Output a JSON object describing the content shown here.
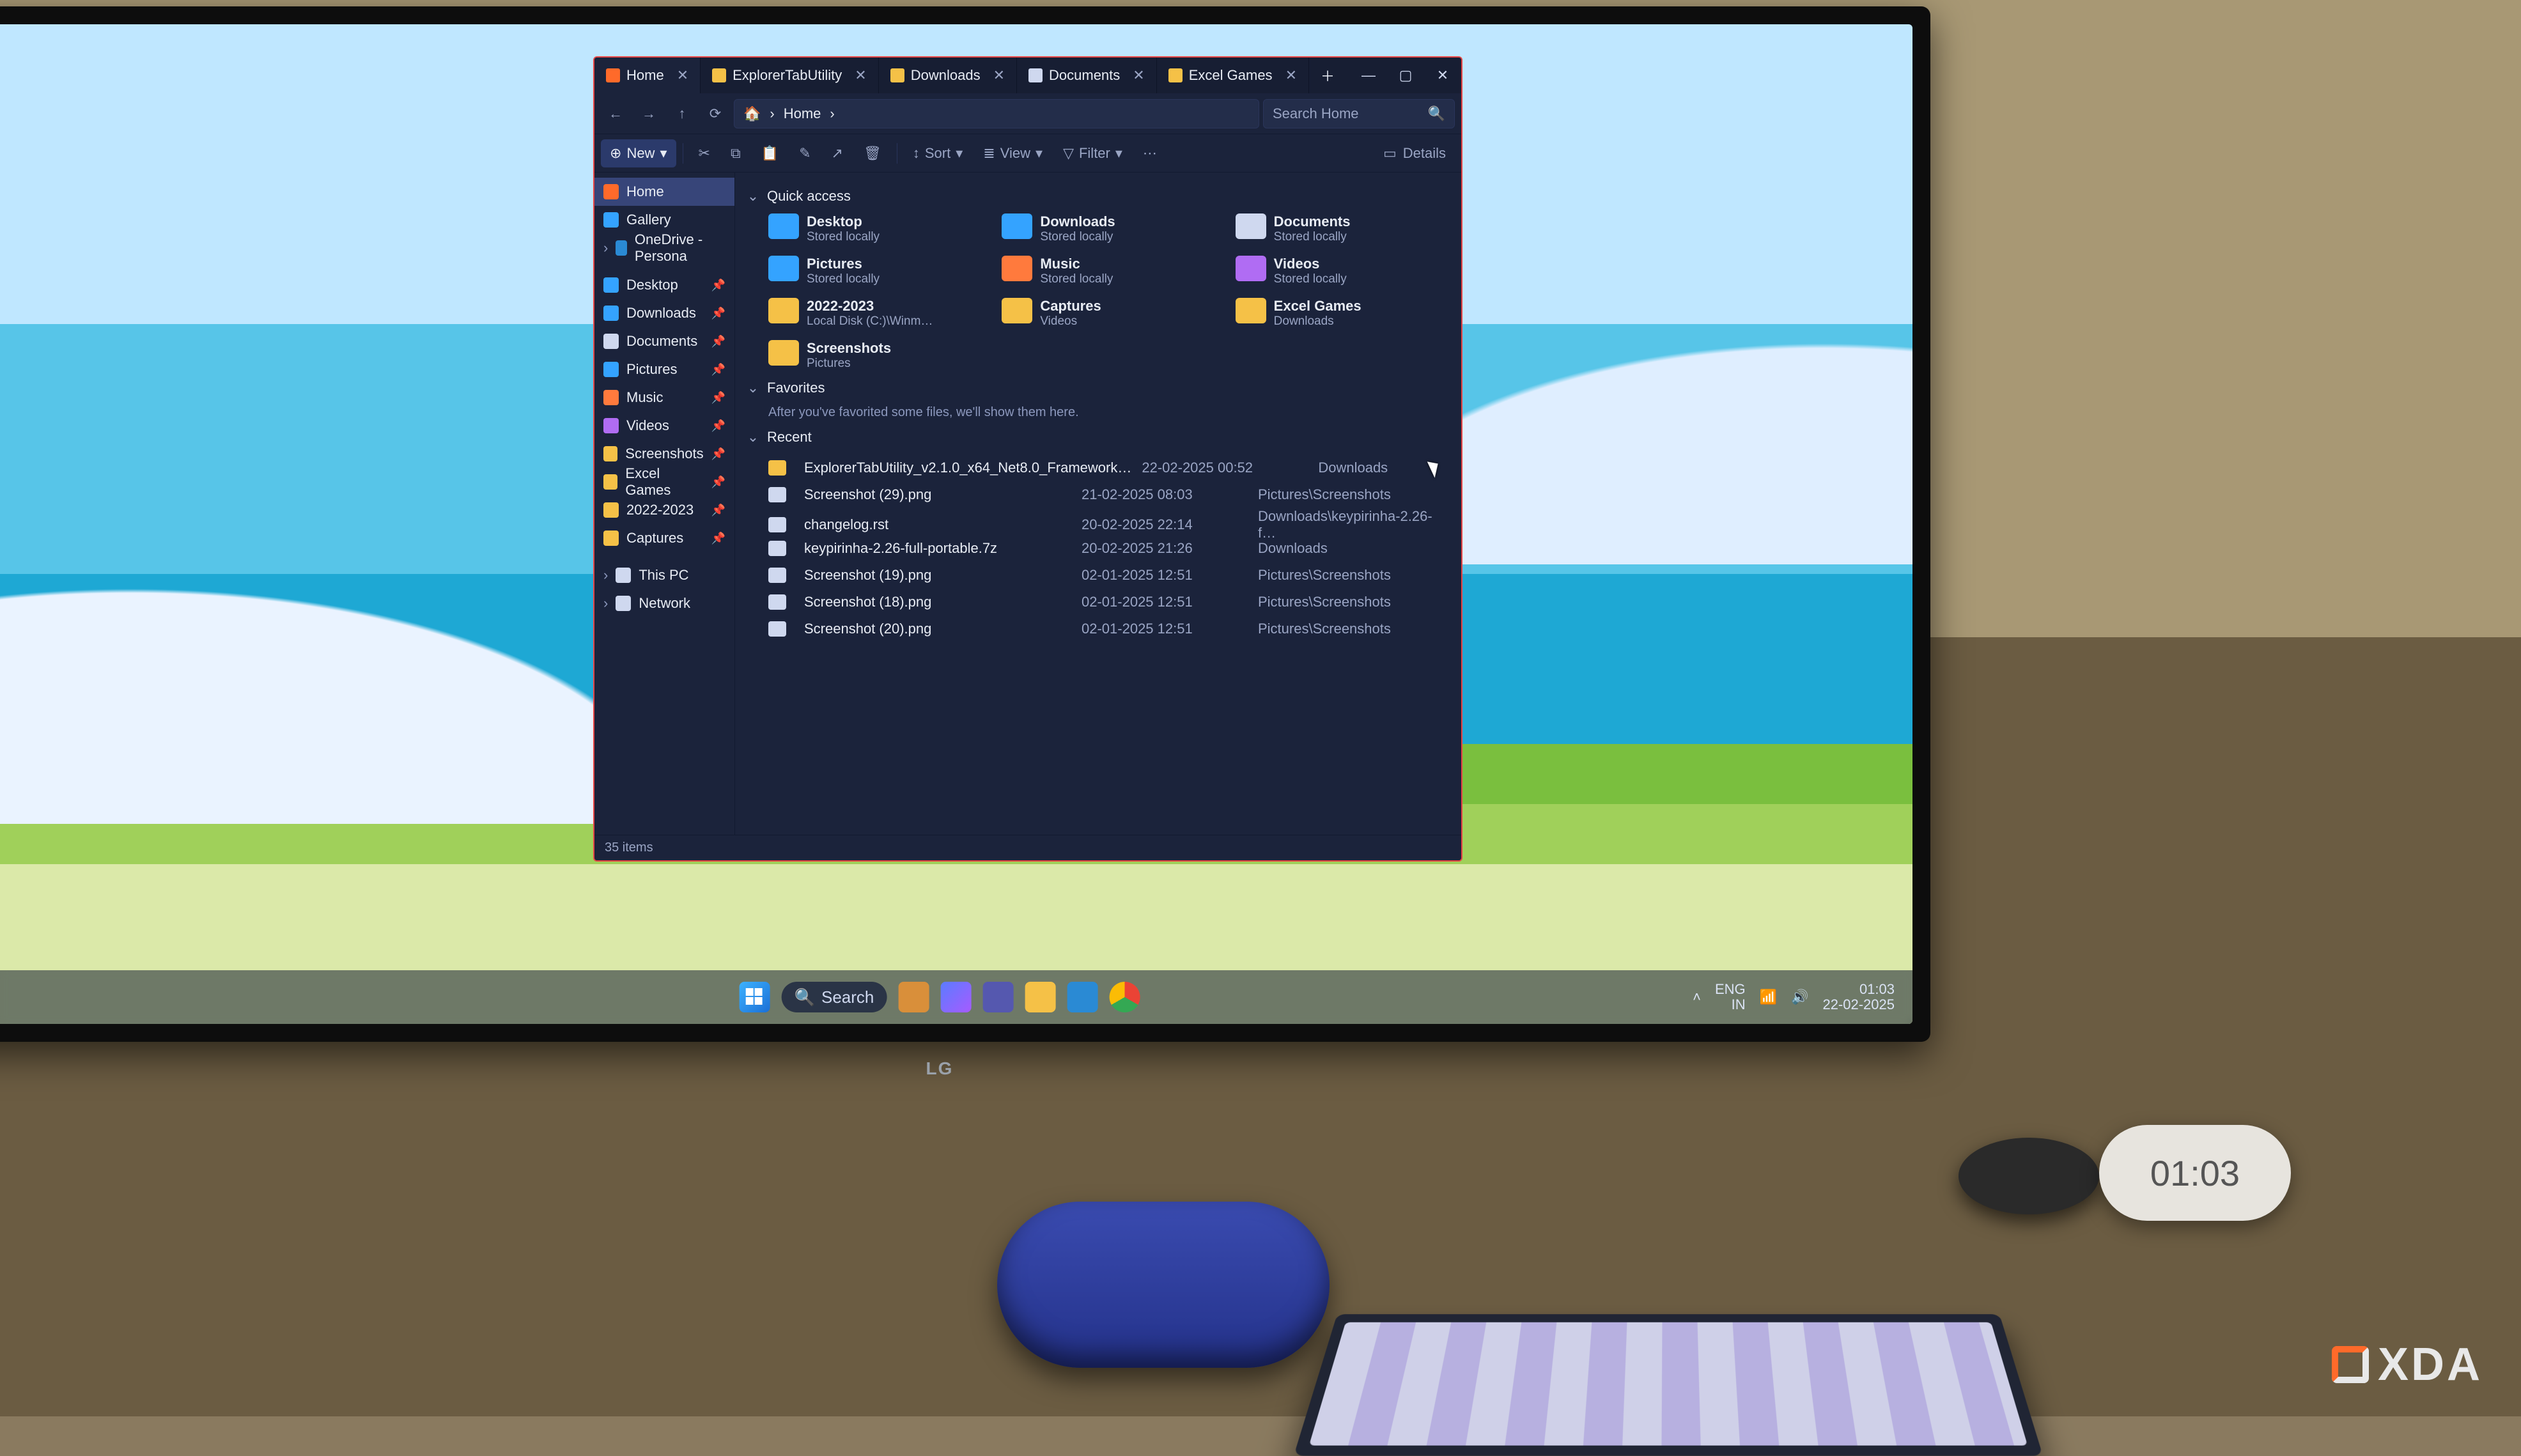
{
  "taskbar": {
    "search_label": "Search",
    "lang_top": "ENG",
    "lang_bottom": "IN",
    "time": "01:03",
    "date": "22-02-2025"
  },
  "desk_clock": "01:03",
  "monitor_brand": "LG",
  "watermark": "XDA",
  "explorer": {
    "tabs": [
      {
        "label": "Home",
        "icon_color": "#ff6a2a",
        "active": true
      },
      {
        "label": "ExplorerTabUtility",
        "icon_color": "#f5c147",
        "active": false
      },
      {
        "label": "Downloads",
        "icon_color": "#f5c147",
        "active": false
      },
      {
        "label": "Documents",
        "icon_color": "#cfd8ef",
        "active": false
      },
      {
        "label": "Excel Games",
        "icon_color": "#f5c147",
        "active": false
      }
    ],
    "breadcrumb": "Home",
    "search_placeholder": "Search Home",
    "toolbar": {
      "new": "New",
      "sort": "Sort",
      "view": "View",
      "filter": "Filter",
      "details": "Details"
    },
    "sidebar": {
      "top": [
        {
          "label": "Home",
          "color": "#ff6a2a",
          "selected": true
        },
        {
          "label": "Gallery",
          "color": "#34a3ff",
          "selected": false
        },
        {
          "label": "OneDrive - Persona",
          "color": "#2a8ad4",
          "selected": false
        }
      ],
      "pinned": [
        {
          "label": "Desktop",
          "color": "#34a3ff"
        },
        {
          "label": "Downloads",
          "color": "#34a3ff"
        },
        {
          "label": "Documents",
          "color": "#cfd8ef"
        },
        {
          "label": "Pictures",
          "color": "#34a3ff"
        },
        {
          "label": "Music",
          "color": "#ff7a3d"
        },
        {
          "label": "Videos",
          "color": "#b06cf3"
        },
        {
          "label": "Screenshots",
          "color": "#f5c147"
        },
        {
          "label": "Excel Games",
          "color": "#f5c147"
        },
        {
          "label": "2022-2023",
          "color": "#f5c147"
        },
        {
          "label": "Captures",
          "color": "#f5c147"
        }
      ],
      "bottom": [
        {
          "label": "This PC",
          "color": "#cfd8ef"
        },
        {
          "label": "Network",
          "color": "#cfd8ef"
        }
      ]
    },
    "sections": {
      "quick_access": "Quick access",
      "favorites": "Favorites",
      "favorites_empty": "After you've favorited some files, we'll show them here.",
      "recent": "Recent"
    },
    "quick_access": [
      {
        "label": "Desktop",
        "sub": "Stored locally",
        "color": "#34a3ff"
      },
      {
        "label": "Downloads",
        "sub": "Stored locally",
        "color": "#34a3ff"
      },
      {
        "label": "Documents",
        "sub": "Stored locally",
        "color": "#cfd8ef"
      },
      {
        "label": "Pictures",
        "sub": "Stored locally",
        "color": "#34a3ff"
      },
      {
        "label": "Music",
        "sub": "Stored locally",
        "color": "#ff7a3d"
      },
      {
        "label": "Videos",
        "sub": "Stored locally",
        "color": "#b06cf3"
      },
      {
        "label": "2022-2023",
        "sub": "Local Disk (C:)\\Winm…",
        "color": "#f5c147"
      },
      {
        "label": "Captures",
        "sub": "Videos",
        "color": "#f5c147"
      },
      {
        "label": "Excel Games",
        "sub": "Downloads",
        "color": "#f5c147"
      },
      {
        "label": "Screenshots",
        "sub": "Pictures",
        "color": "#f5c147"
      }
    ],
    "recent": [
      {
        "name": "ExplorerTabUtility_v2.1.0_x64_Net8.0_Framework…",
        "date": "22-02-2025 00:52",
        "loc": "Downloads",
        "color": "#f5c147"
      },
      {
        "name": "Screenshot (29).png",
        "date": "21-02-2025 08:03",
        "loc": "Pictures\\Screenshots",
        "color": "#cfd8ef"
      },
      {
        "name": "changelog.rst",
        "date": "20-02-2025 22:14",
        "loc": "Downloads\\keypirinha-2.26-f…",
        "color": "#cfd8ef"
      },
      {
        "name": "keypirinha-2.26-full-portable.7z",
        "date": "20-02-2025 21:26",
        "loc": "Downloads",
        "color": "#cfd8ef"
      },
      {
        "name": "Screenshot (19).png",
        "date": "02-01-2025 12:51",
        "loc": "Pictures\\Screenshots",
        "color": "#cfd8ef"
      },
      {
        "name": "Screenshot (18).png",
        "date": "02-01-2025 12:51",
        "loc": "Pictures\\Screenshots",
        "color": "#cfd8ef"
      },
      {
        "name": "Screenshot (20).png",
        "date": "02-01-2025 12:51",
        "loc": "Pictures\\Screenshots",
        "color": "#cfd8ef"
      }
    ],
    "status": "35 items"
  }
}
